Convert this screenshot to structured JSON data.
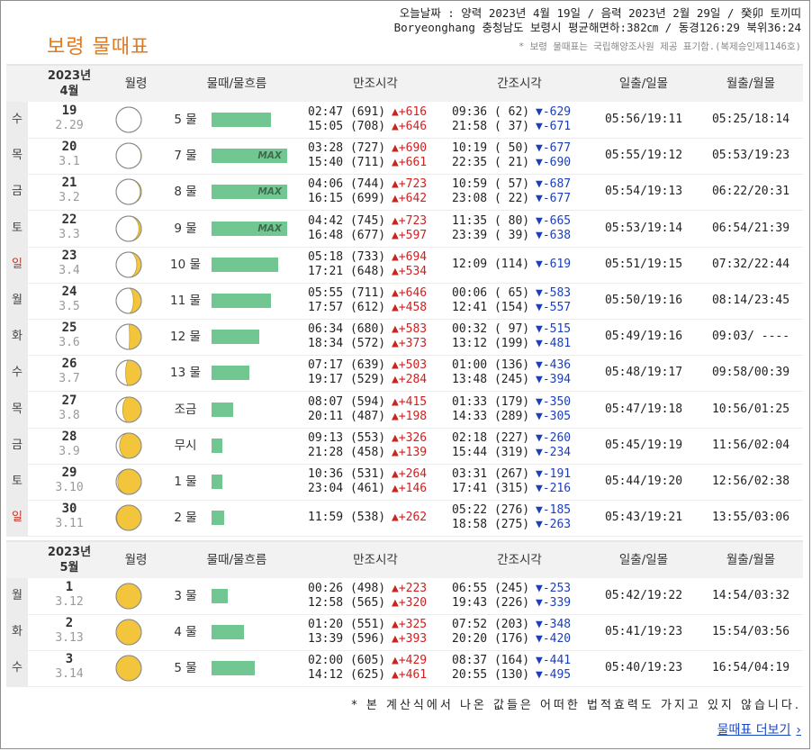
{
  "header": {
    "title": "보령 물때표",
    "line1": "오늘날짜 : 양력 2023년 4월 19일 / 음력 2023년 2월 29일 / 癸卯 토끼띠",
    "line2": "Boryeonghang 충청남도 보령시 평균해면하:382㎝ / 동경126:29 북위36:24",
    "note": "* 보령 물때표는 국립해양조사원 제공 표기함.(복제승인제1146호)"
  },
  "columns": {
    "moon": "월령",
    "tide": "물때/물흐름",
    "high": "만조시각",
    "low": "간조시각",
    "sun": "일출/일몰",
    "moonrise": "월출/월몰"
  },
  "sections": [
    {
      "year": "2023년",
      "month": "4월",
      "rows": [
        {
          "dow": "수",
          "sunday": false,
          "day": "19",
          "lunar": "2.29",
          "phase": 0.02,
          "tide": "5 물",
          "flow": 0.78,
          "max": "",
          "h1": "02:47 (691)",
          "h1d": "▲+616",
          "h2": "15:05 (708)",
          "h2d": "▲+646",
          "l1": "09:36 ( 62)",
          "l1d": "▼-629",
          "l2": "21:58 ( 37)",
          "l2d": "▼-671",
          "sun": "05:56/19:11",
          "moon": "05:25/18:14"
        },
        {
          "dow": "목",
          "sunday": false,
          "day": "20",
          "lunar": "3.1",
          "phase": 0.04,
          "tide": "7 물",
          "flow": 1.0,
          "max": "MAX",
          "h1": "03:28 (727)",
          "h1d": "▲+690",
          "h2": "15:40 (711)",
          "h2d": "▲+661",
          "l1": "10:19 ( 50)",
          "l1d": "▼-677",
          "l2": "22:35 ( 21)",
          "l2d": "▼-690",
          "sun": "05:55/19:12",
          "moon": "05:53/19:23"
        },
        {
          "dow": "금",
          "sunday": false,
          "day": "21",
          "lunar": "3.2",
          "phase": 0.07,
          "tide": "8 물",
          "flow": 1.0,
          "max": "MAX",
          "h1": "04:06 (744)",
          "h1d": "▲+723",
          "h2": "16:15 (699)",
          "h2d": "▲+642",
          "l1": "10:59 ( 57)",
          "l1d": "▼-687",
          "l2": "23:08 ( 22)",
          "l2d": "▼-677",
          "sun": "05:54/19:13",
          "moon": "06:22/20:31"
        },
        {
          "dow": "토",
          "sunday": false,
          "day": "22",
          "lunar": "3.3",
          "phase": 0.1,
          "tide": "9 물",
          "flow": 1.0,
          "max": "MAX",
          "h1": "04:42 (745)",
          "h1d": "▲+723",
          "h2": "16:48 (677)",
          "h2d": "▲+597",
          "l1": "11:35 ( 80)",
          "l1d": "▼-665",
          "l2": "23:39 ( 39)",
          "l2d": "▼-638",
          "sun": "05:53/19:14",
          "moon": "06:54/21:39"
        },
        {
          "dow": "일",
          "sunday": true,
          "day": "23",
          "lunar": "3.4",
          "phase": 0.14,
          "tide": "10 물",
          "flow": 0.88,
          "max": "",
          "h1": "05:18 (733)",
          "h1d": "▲+694",
          "h2": "17:21 (648)",
          "h2d": "▲+534",
          "l1": "12:09 (114)",
          "l1d": "▼-619",
          "l2": "",
          "l2d": "",
          "sun": "05:51/19:15",
          "moon": "07:32/22:44"
        },
        {
          "dow": "월",
          "sunday": false,
          "day": "24",
          "lunar": "3.5",
          "phase": 0.19,
          "tide": "11 물",
          "flow": 0.78,
          "max": "",
          "h1": "05:55 (711)",
          "h1d": "▲+646",
          "h2": "17:57 (612)",
          "h2d": "▲+458",
          "l1": "00:06 ( 65)",
          "l1d": "▼-583",
          "l2": "12:41 (154)",
          "l2d": "▼-557",
          "sun": "05:50/19:16",
          "moon": "08:14/23:45"
        },
        {
          "dow": "화",
          "sunday": false,
          "day": "25",
          "lunar": "3.6",
          "phase": 0.24,
          "tide": "12 물",
          "flow": 0.63,
          "max": "",
          "h1": "06:34 (680)",
          "h1d": "▲+583",
          "h2": "18:34 (572)",
          "h2d": "▲+373",
          "l1": "00:32 ( 97)",
          "l1d": "▼-515",
          "l2": "13:12 (199)",
          "l2d": "▼-481",
          "sun": "05:49/19:16",
          "moon": "09:03/ ----"
        },
        {
          "dow": "수",
          "sunday": false,
          "day": "26",
          "lunar": "3.7",
          "phase": 0.29,
          "tide": "13 물",
          "flow": 0.5,
          "max": "",
          "h1": "07:17 (639)",
          "h1d": "▲+503",
          "h2": "19:17 (529)",
          "h2d": "▲+284",
          "l1": "01:00 (136)",
          "l1d": "▼-436",
          "l2": "13:48 (245)",
          "l2d": "▼-394",
          "sun": "05:48/19:17",
          "moon": "09:58/00:39"
        },
        {
          "dow": "목",
          "sunday": false,
          "day": "27",
          "lunar": "3.8",
          "phase": 0.33,
          "tide": "조금",
          "flow": 0.28,
          "max": "",
          "h1": "08:07 (594)",
          "h1d": "▲+415",
          "h2": "20:11 (487)",
          "h2d": "▲+198",
          "l1": "01:33 (179)",
          "l1d": "▼-350",
          "l2": "14:33 (289)",
          "l2d": "▼-305",
          "sun": "05:47/19:18",
          "moon": "10:56/01:25"
        },
        {
          "dow": "금",
          "sunday": false,
          "day": "28",
          "lunar": "3.9",
          "phase": 0.38,
          "tide": "무시",
          "flow": 0.14,
          "max": "",
          "h1": "09:13 (553)",
          "h1d": "▲+326",
          "h2": "21:28 (458)",
          "h2d": "▲+139",
          "l1": "02:18 (227)",
          "l1d": "▼-260",
          "l2": "15:44 (319)",
          "l2d": "▼-234",
          "sun": "05:45/19:19",
          "moon": "11:56/02:04"
        },
        {
          "dow": "토",
          "sunday": false,
          "day": "29",
          "lunar": "3.10",
          "phase": 0.42,
          "tide": "1 물",
          "flow": 0.14,
          "max": "",
          "h1": "10:36 (531)",
          "h1d": "▲+264",
          "h2": "23:04 (461)",
          "h2d": "▲+146",
          "l1": "03:31 (267)",
          "l1d": "▼-191",
          "l2": "17:41 (315)",
          "l2d": "▼-216",
          "sun": "05:44/19:20",
          "moon": "12:56/02:38"
        },
        {
          "dow": "일",
          "sunday": true,
          "day": "30",
          "lunar": "3.11",
          "phase": 0.45,
          "tide": "2 물",
          "flow": 0.17,
          "max": "",
          "h1": "11:59 (538)",
          "h1d": "▲+262",
          "h2": "",
          "h2d": "",
          "l1": "05:22 (276)",
          "l1d": "▼-185",
          "l2": "18:58 (275)",
          "l2d": "▼-263",
          "sun": "05:43/19:21",
          "moon": "13:55/03:06"
        }
      ]
    },
    {
      "year": "2023년",
      "month": "5월",
      "rows": [
        {
          "dow": "월",
          "sunday": false,
          "day": "1",
          "lunar": "3.12",
          "phase": 0.47,
          "tide": "3 물",
          "flow": 0.22,
          "max": "",
          "h1": "00:26 (498)",
          "h1d": "▲+223",
          "h2": "12:58 (565)",
          "h2d": "▲+320",
          "l1": "06:55 (245)",
          "l1d": "▼-253",
          "l2": "19:43 (226)",
          "l2d": "▼-339",
          "sun": "05:42/19:22",
          "moon": "14:54/03:32"
        },
        {
          "dow": "화",
          "sunday": false,
          "day": "2",
          "lunar": "3.13",
          "phase": 0.49,
          "tide": "4 물",
          "flow": 0.43,
          "max": "",
          "h1": "01:20 (551)",
          "h1d": "▲+325",
          "h2": "13:39 (596)",
          "h2d": "▲+393",
          "l1": "07:52 (203)",
          "l1d": "▼-348",
          "l2": "20:20 (176)",
          "l2d": "▼-420",
          "sun": "05:41/19:23",
          "moon": "15:54/03:56"
        },
        {
          "dow": "수",
          "sunday": false,
          "day": "3",
          "lunar": "3.14",
          "phase": 0.5,
          "tide": "5 물",
          "flow": 0.57,
          "max": "",
          "h1": "02:00 (605)",
          "h1d": "▲+429",
          "h2": "14:12 (625)",
          "h2d": "▲+461",
          "l1": "08:37 (164)",
          "l1d": "▼-441",
          "l2": "20:55 (130)",
          "l2d": "▼-495",
          "sun": "05:40/19:23",
          "moon": "16:54/04:19"
        }
      ]
    }
  ],
  "footer": {
    "disclaimer": "* 본 계산식에서 나온 값들은 어떠한 법적효력도 가지고 있지 않습니다.",
    "more_link": "물때표 더보기",
    "more_arrow": "›"
  },
  "colors": {
    "title": "#e07b22",
    "bar": "#71c691",
    "moon_lit": "#f2c53d",
    "up": "#cc2222",
    "down": "#1c3fb8",
    "sunday": "#c0392b"
  }
}
